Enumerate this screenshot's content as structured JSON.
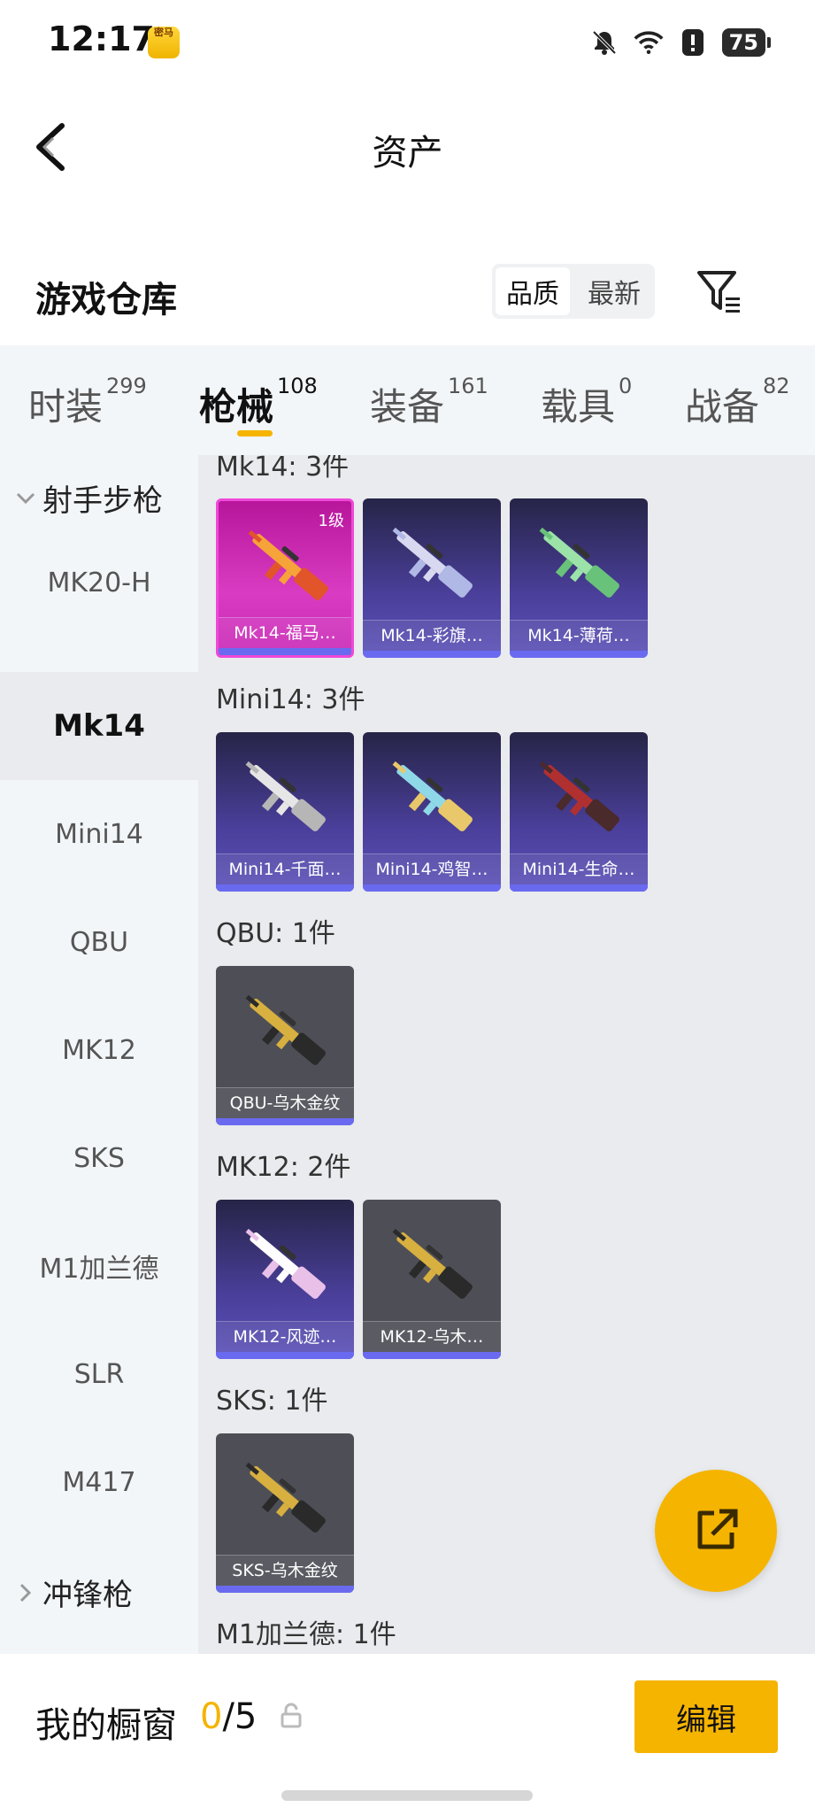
{
  "status_bar": {
    "time": "12:17",
    "app_badge": "密马",
    "battery": "75",
    "icons": [
      "bell-muted-icon",
      "wifi-icon",
      "alert-icon",
      "battery-icon"
    ]
  },
  "header": {
    "title": "资产",
    "back_icon": "chevron-left-icon"
  },
  "warehouse": {
    "title": "游戏仓库",
    "sort_options": [
      "品质",
      "最新"
    ],
    "sort_active": "品质",
    "filter_icon": "filter-icon"
  },
  "tabs": [
    {
      "label": "时装",
      "count": "299"
    },
    {
      "label": "枪械",
      "count": "108",
      "active": true
    },
    {
      "label": "装备",
      "count": "161"
    },
    {
      "label": "载具",
      "count": "0"
    },
    {
      "label": "战备",
      "count": "82"
    }
  ],
  "sidebar": {
    "group_top": "射手步枪",
    "items": [
      "MK20-H",
      "Mk14",
      "Mini14",
      "QBU",
      "MK12",
      "SKS",
      "M1加兰德",
      "SLR",
      "M417"
    ],
    "active": "Mk14",
    "group_bottom": "冲锋枪"
  },
  "groups": [
    {
      "label": "Mk14: 3件",
      "items": [
        {
          "name": "Mk14-福马…",
          "rarity": "pink",
          "level": "1级",
          "colors": [
            "#f6a33a",
            "#e2542a"
          ]
        },
        {
          "name": "Mk14-彩旗…",
          "rarity": "purple",
          "colors": [
            "#d8d8f0",
            "#b0b8e6"
          ]
        },
        {
          "name": "Mk14-薄荷…",
          "rarity": "purple",
          "colors": [
            "#9be3a8",
            "#69c27a"
          ]
        }
      ]
    },
    {
      "label": "Mini14: 3件",
      "items": [
        {
          "name": "Mini14-千面…",
          "rarity": "purple",
          "colors": [
            "#e6e6e6",
            "#b6b6b6"
          ]
        },
        {
          "name": "Mini14-鸡智…",
          "rarity": "purple",
          "colors": [
            "#8fd8e8",
            "#e8c86a"
          ]
        },
        {
          "name": "Mini14-生命…",
          "rarity": "purple",
          "colors": [
            "#b03030",
            "#4a2a2a"
          ]
        }
      ]
    },
    {
      "label": "QBU: 1件",
      "items": [
        {
          "name": "QBU-乌木金纹",
          "rarity": "grey",
          "colors": [
            "#d8b040",
            "#2a2a2a"
          ]
        }
      ]
    },
    {
      "label": "MK12: 2件",
      "items": [
        {
          "name": "MK12-风迹…",
          "rarity": "purple",
          "colors": [
            "#ffffff",
            "#e8c0e8"
          ]
        },
        {
          "name": "MK12-乌木…",
          "rarity": "grey",
          "colors": [
            "#d8b040",
            "#2a2a2a"
          ]
        }
      ]
    },
    {
      "label": "SKS: 1件",
      "items": [
        {
          "name": "SKS-乌木金纹",
          "rarity": "grey",
          "colors": [
            "#d8b040",
            "#2a2a2a"
          ]
        }
      ]
    },
    {
      "label": "M1加兰德: 1件",
      "items": []
    }
  ],
  "fab": {
    "icon": "share-external-icon"
  },
  "showcase": {
    "title": "我的橱窗",
    "current": "0",
    "total": "/5",
    "lock_icon": "lock-icon",
    "edit_label": "编辑"
  }
}
